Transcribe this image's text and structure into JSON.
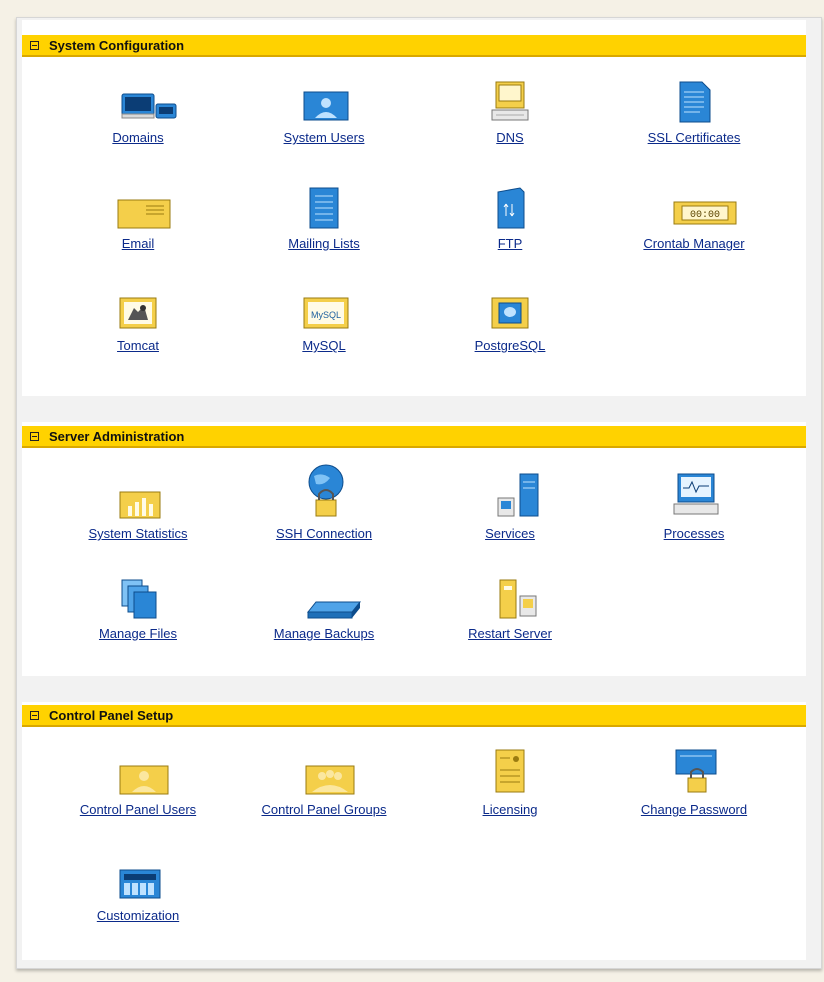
{
  "sections": [
    {
      "title": "System Configuration",
      "items": [
        {
          "label": "Domains",
          "icon": "domains-icon"
        },
        {
          "label": "System Users",
          "icon": "system-users-icon"
        },
        {
          "label": "DNS",
          "icon": "dns-icon"
        },
        {
          "label": "SSL Certificates",
          "icon": "ssl-certificates-icon"
        },
        {
          "label": "Email",
          "icon": "email-icon"
        },
        {
          "label": "Mailing Lists",
          "icon": "mailing-lists-icon"
        },
        {
          "label": "FTP",
          "icon": "ftp-icon"
        },
        {
          "label": "Crontab Manager",
          "icon": "crontab-manager-icon"
        },
        {
          "label": "Tomcat",
          "icon": "tomcat-icon"
        },
        {
          "label": "MySQL",
          "icon": "mysql-icon"
        },
        {
          "label": "PostgreSQL",
          "icon": "postgresql-icon"
        }
      ]
    },
    {
      "title": "Server Administration",
      "items": [
        {
          "label": "System Statistics",
          "icon": "system-statistics-icon"
        },
        {
          "label": "SSH Connection",
          "icon": "ssh-connection-icon"
        },
        {
          "label": "Services",
          "icon": "services-icon"
        },
        {
          "label": "Processes",
          "icon": "processes-icon"
        },
        {
          "label": "Manage Files",
          "icon": "manage-files-icon"
        },
        {
          "label": "Manage Backups",
          "icon": "manage-backups-icon"
        },
        {
          "label": "Restart Server",
          "icon": "restart-server-icon"
        }
      ]
    },
    {
      "title": "Control Panel Setup",
      "items": [
        {
          "label": "Control Panel Users",
          "icon": "control-panel-users-icon"
        },
        {
          "label": "Control Panel Groups",
          "icon": "control-panel-groups-icon"
        },
        {
          "label": "Licensing",
          "icon": "licensing-icon"
        },
        {
          "label": "Change Password",
          "icon": "change-password-icon"
        },
        {
          "label": "Customization",
          "icon": "customization-icon"
        }
      ]
    }
  ],
  "icon_text": {
    "crontab": "00:00",
    "mysql": "MySQL"
  },
  "colors": {
    "header_bg": "#ffd200",
    "link": "#0b2a8a",
    "icon_blue": "#2a86d6",
    "icon_yellow": "#f4cf4a"
  }
}
